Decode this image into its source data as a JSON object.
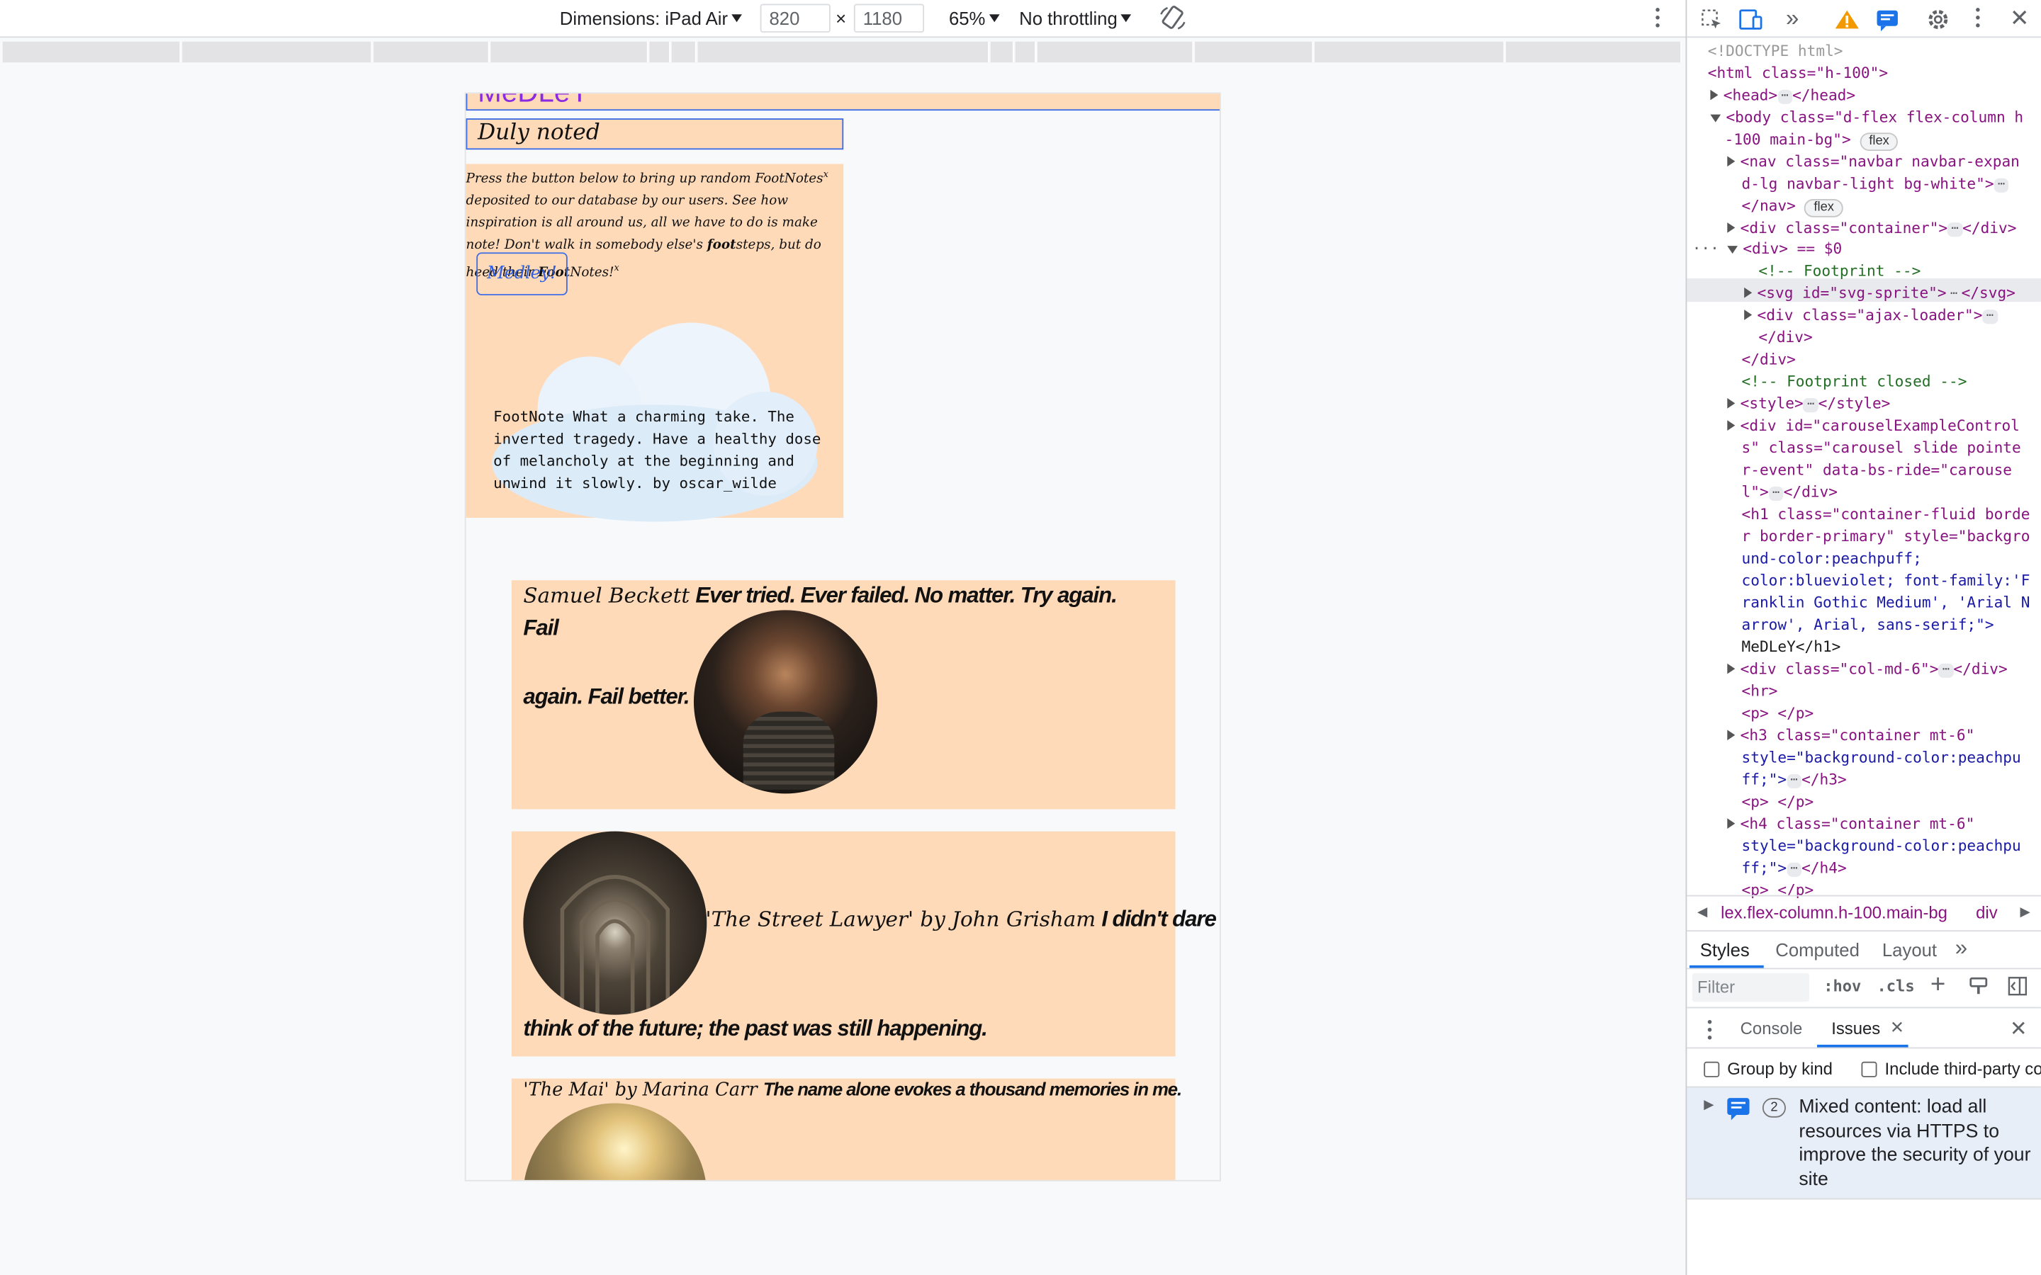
{
  "device_toolbar": {
    "dimensions_label": "Dimensions: iPad Air",
    "width": "820",
    "times": "×",
    "height": "1180",
    "zoom": "65%",
    "throttling": "No throttling"
  },
  "page": {
    "brand": "MeDLeY",
    "heading": "Duly noted",
    "intro_part1": "Press the button below to bring up random FootNotes",
    "intro_sup1": "x",
    "intro_part2": " deposited to our database by our users. See how inspiration is all around us, all we have to do is make note! Don't walk in somebody else's ",
    "intro_bold": "foot",
    "intro_part3": "steps, but do heed their ",
    "intro_bold2": "Foot",
    "intro_part4": "Notes!",
    "intro_sup2": "x",
    "medley_button": "Medley!",
    "footnote": "FootNote What a charming take. The inverted tragedy. Have a healthy dose of melancholy at the beginning and unwind it slowly. by oscar_wilde",
    "quotes": [
      {
        "author": "Samuel Beckett",
        "text_line1": "Ever tried. Ever failed. No matter. Try again. Fail",
        "text_line2": "again. Fail better."
      },
      {
        "author": "'The Street Lawyer' by John Grisham",
        "text_line1": "I didn't dare",
        "text_line2": "think of the future; the past was still happening."
      },
      {
        "author": "'The Mai' by Marina Carr",
        "text_line1": "The name alone evokes a thousand memories in me."
      }
    ]
  },
  "devtools": {
    "warning_count": "",
    "elements": [
      "<!DOCTYPE html>",
      "<html class=\"h-100\">",
      "<head>",
      "</head>",
      "<body class=\"d-flex flex-column h",
      "-100 main-bg\">",
      "flex",
      "<nav class=\"navbar navbar-expan",
      "d-lg navbar-light bg-white\">",
      "</nav>",
      "<div class=\"container\">",
      "</div>",
      "<div> == $0",
      "<!-- Footprint -->",
      "<svg id=\"svg-sprite\">",
      "</svg>",
      "<div class=\"ajax-loader\">",
      "</div>",
      "</div>",
      "<!-- Footprint closed -->",
      "<style>",
      "</style>",
      "<div id=\"carouselExampleControl",
      "s\" class=\"carousel slide pointe",
      "r-event\" data-bs-ride=\"carouse",
      "l\">",
      "</div>",
      "<h1 class=\"container-fluid borde",
      "r border-primary\" style=\"backgro",
      "und-color:peachpuff;",
      "color:blueviolet; font-family:'F",
      "ranklin Gothic Medium', 'Arial N",
      "arrow', Arial, sans-serif;\">",
      "MeDLeY</h1>",
      "<div class=\"col-md-6\">",
      "</div>",
      "<hr>",
      "<p> </p>",
      "<h3 class=\"container mt-6\"",
      "style=\"background-color:peachpu",
      "ff;\">",
      "</h3>",
      "<p> </p>",
      "<h4 class=\"container mt-6\"",
      "style=\"background-color:peachpu",
      "ff;\">",
      "</h4>",
      "<p> </p>"
    ],
    "breadcrumb_1": "lex.flex-column.h-100.main-bg",
    "breadcrumb_2": "div",
    "tabs": [
      "Styles",
      "Computed",
      "Layout"
    ],
    "filter_placeholder": "Filter",
    "hov": ":hov",
    "cls": ".cls",
    "drawer_tabs": [
      "Console",
      "Issues"
    ],
    "group_by_kind": "Group by kind",
    "include_third_party": "Include third-party co",
    "issue_count": "2",
    "issue_text": "Mixed content: load all resources via HTTPS to improve the security of your site"
  }
}
